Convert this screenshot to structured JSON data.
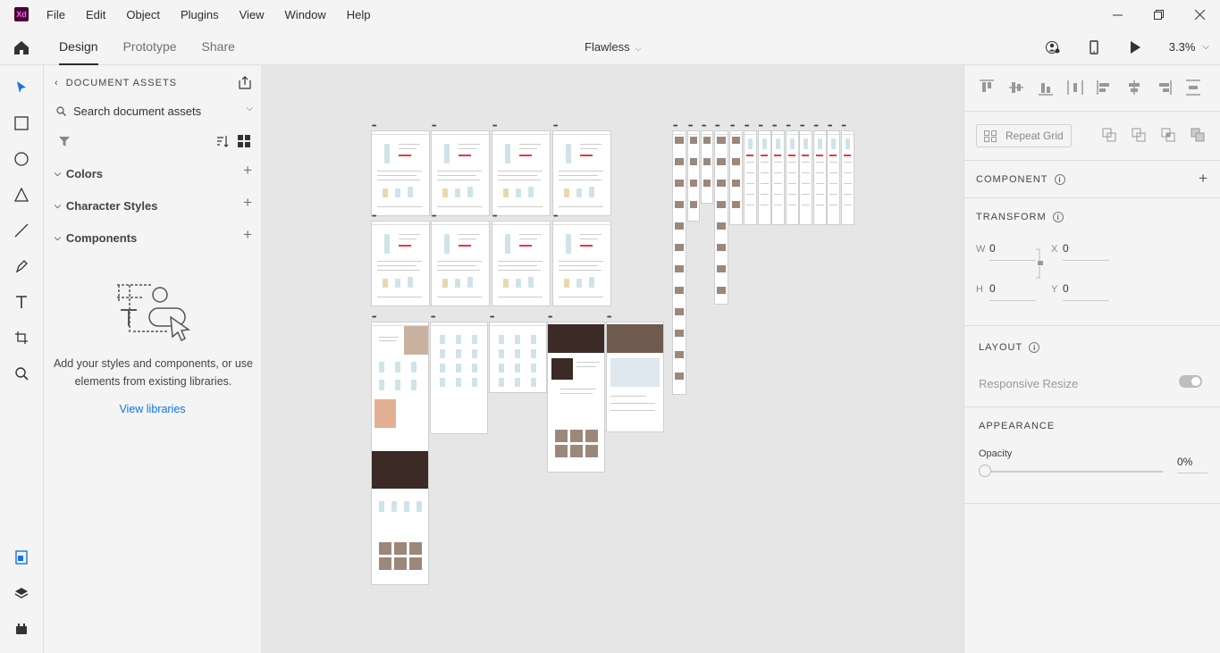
{
  "app": {
    "logo_text": "Xd"
  },
  "menu": [
    "File",
    "Edit",
    "Object",
    "Plugins",
    "View",
    "Window",
    "Help"
  ],
  "workspace_tabs": [
    {
      "label": "Design",
      "active": true
    },
    {
      "label": "Prototype",
      "active": false
    },
    {
      "label": "Share",
      "active": false
    }
  ],
  "document": {
    "title": "Flawless"
  },
  "zoom": {
    "value": "3.3%"
  },
  "assets": {
    "heading": "DOCUMENT ASSETS",
    "search_placeholder": "Search document assets",
    "sections": [
      "Colors",
      "Character Styles",
      "Components"
    ],
    "empty_message": "Add your styles and components, or use elements from existing libraries.",
    "view_libraries": "View libraries"
  },
  "properties": {
    "repeat_grid": "Repeat Grid",
    "component": "COMPONENT",
    "transform": "TRANSFORM",
    "w_label": "W",
    "w_value": "0",
    "x_label": "X",
    "x_value": "0",
    "h_label": "H",
    "h_value": "0",
    "y_label": "Y",
    "y_value": "0",
    "layout": "LAYOUT",
    "responsive_resize": "Responsive Resize",
    "appearance": "APPEARANCE",
    "opacity_label": "Opacity",
    "opacity_value": "0%"
  },
  "colors": {
    "accent_blue": "#1473e6",
    "xd_brand": "#470137",
    "xd_pink": "#ff61f6"
  }
}
